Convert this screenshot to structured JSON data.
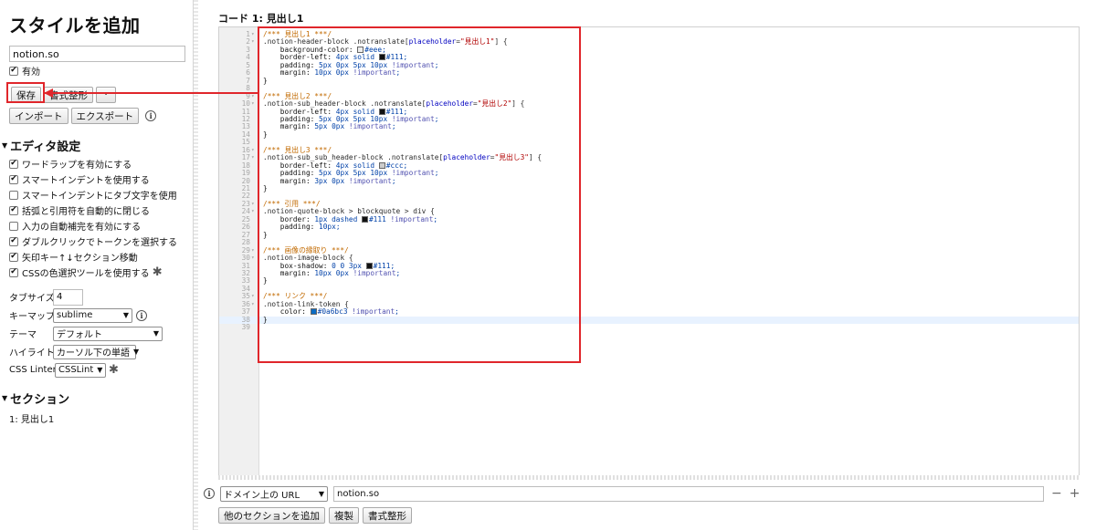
{
  "sidebar": {
    "title": "スタイルを追加",
    "name_value": "notion.so",
    "enabled_label": "有効",
    "buttons": {
      "save": "保存",
      "beautify": "書式整形",
      "more": "·",
      "import": "インポート",
      "export": "エクスポート"
    },
    "info_glyph": "i",
    "editor_settings": {
      "heading": "エディタ設定",
      "options": [
        {
          "label": "ワードラップを有効にする",
          "checked": true
        },
        {
          "label": "スマートインデントを使用する",
          "checked": true
        },
        {
          "label": "スマートインデントにタブ文字を使用",
          "checked": false
        },
        {
          "label": "括弧と引用符を自動的に閉じる",
          "checked": true
        },
        {
          "label": "入力の自動補完を有効にする",
          "checked": false
        },
        {
          "label": "ダブルクリックでトークンを選択する",
          "checked": true
        },
        {
          "label": "矢印キー↑↓セクション移動",
          "checked": true
        },
        {
          "label": "CSSの色選択ツールを使用する",
          "checked": true
        }
      ],
      "tab_size_label": "タブサイズ",
      "tab_size_value": "4",
      "keymap_label": "キーマップ",
      "keymap_value": "sublime",
      "theme_label": "テーマ",
      "theme_value": "デフォルト",
      "highlight_label": "ハイライト",
      "highlight_value": "カーソル下の単語",
      "linter_label": "CSS Linter",
      "linter_value": "CSSLint"
    },
    "sections": {
      "heading": "セクション",
      "items": [
        "1: 見出し1"
      ]
    }
  },
  "main": {
    "code_title": "コード 1: 見出し1",
    "code_lines": [
      "/*** 見出し1 ***/",
      ".notion-header-block .notranslate[placeholder=\"見出し1\"] {",
      "    background-color: #eee;",
      "    border-left: 4px solid #111;",
      "    padding: 5px 0px 5px 10px !important;",
      "    margin: 10px 0px !important;",
      "}",
      "",
      "/*** 見出し2 ***/",
      ".notion-sub_header-block .notranslate[placeholder=\"見出し2\"] {",
      "    border-left: 4px solid #111;",
      "    padding: 5px 0px 5px 10px !important;",
      "    margin: 5px 0px !important;",
      "}",
      "",
      "/*** 見出し3 ***/",
      ".notion-sub_sub_header-block .notranslate[placeholder=\"見出し3\"] {",
      "    border-left: 4px solid #ccc;",
      "    padding: 5px 0px 5px 10px !important;",
      "    margin: 3px 0px !important;",
      "}",
      "",
      "/*** 引用 ***/",
      ".notion-quote-block > blockquote > div {",
      "    border: 1px dashed #111 !important;",
      "    padding: 10px;",
      "}",
      "",
      "/*** 画像の縁取り ***/",
      ".notion-image-block {",
      "    box-shadow: 0 0 3px #111;",
      "    margin: 10px 0px !important;",
      "}",
      "",
      "/*** リンク ***/",
      ".notion-link-token {",
      "    color: #0a6bc3 !important;",
      "}"
    ],
    "swatch_colors": {
      "#eee": "#eeeeee",
      "#111": "#111111",
      "#ccc": "#cccccc",
      "#0a6bc3": "#0a6bc3"
    },
    "applies_to": {
      "type_value": "ドメイン上の URL",
      "url_value": "notion.so",
      "minus": "−",
      "plus": "+"
    },
    "bottom_buttons": {
      "add_section": "他のセクションを追加",
      "clone": "複製",
      "beautify": "書式整形"
    }
  },
  "colors": {
    "annotation": "#e0262b"
  }
}
